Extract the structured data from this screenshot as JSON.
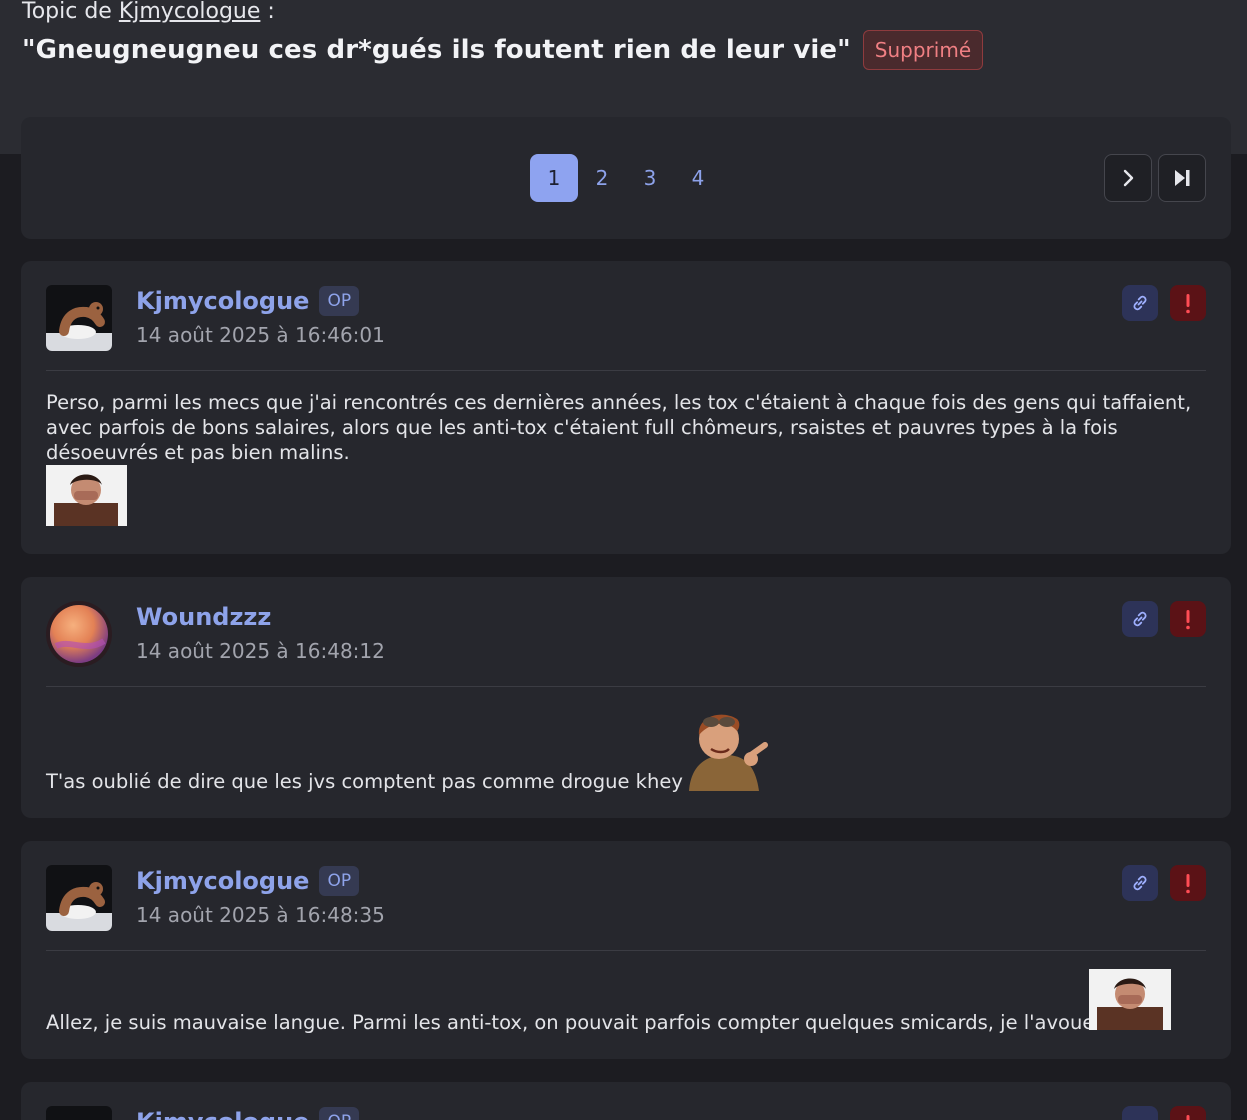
{
  "header": {
    "topic_prefix": "Topic de",
    "author": "Kjmycologue",
    "suffix": " :",
    "title": "\"Gneugneugneu ces dr*gués ils foutent rien de leur vie\"",
    "badge": "Supprimé"
  },
  "pagination": {
    "pages": [
      "1",
      "2",
      "3",
      "4"
    ],
    "current": "1",
    "next_icon": "chevron-right-icon",
    "last_icon": "skip-to-end-icon"
  },
  "posts": [
    {
      "username": "Kjmycologue",
      "op_badge": "OP",
      "date": "14 août 2025 à 16:46:01",
      "body": "Perso, parmi les mecs que j'ai rencontrés ces dernières années, les tox c'étaient à chaque fois des gens qui taffaient, avec parfois de bons salaires, alors que les anti-tox c'étaient full chômeurs, rsaistes et pauvres types à la fois désoeuvrés et pas bien malins."
    },
    {
      "username": "Woundzzz",
      "date": "14 août 2025 à 16:48:12",
      "body": "T'as oublié de dire que les jvs comptent pas comme drogue khey"
    },
    {
      "username": "Kjmycologue",
      "op_badge": "OP",
      "date": "14 août 2025 à 16:48:35",
      "body": "Allez, je suis mauvaise langue. Parmi les anti-tox, on pouvait parfois compter quelques smicards, je l'avoue"
    },
    {
      "username": "Kjmycologue",
      "op_badge": "OP"
    }
  ],
  "colors": {
    "accent": "#8ea3f0",
    "danger": "#5b1216",
    "background": "#1c1c21",
    "panel": "#26272d"
  }
}
